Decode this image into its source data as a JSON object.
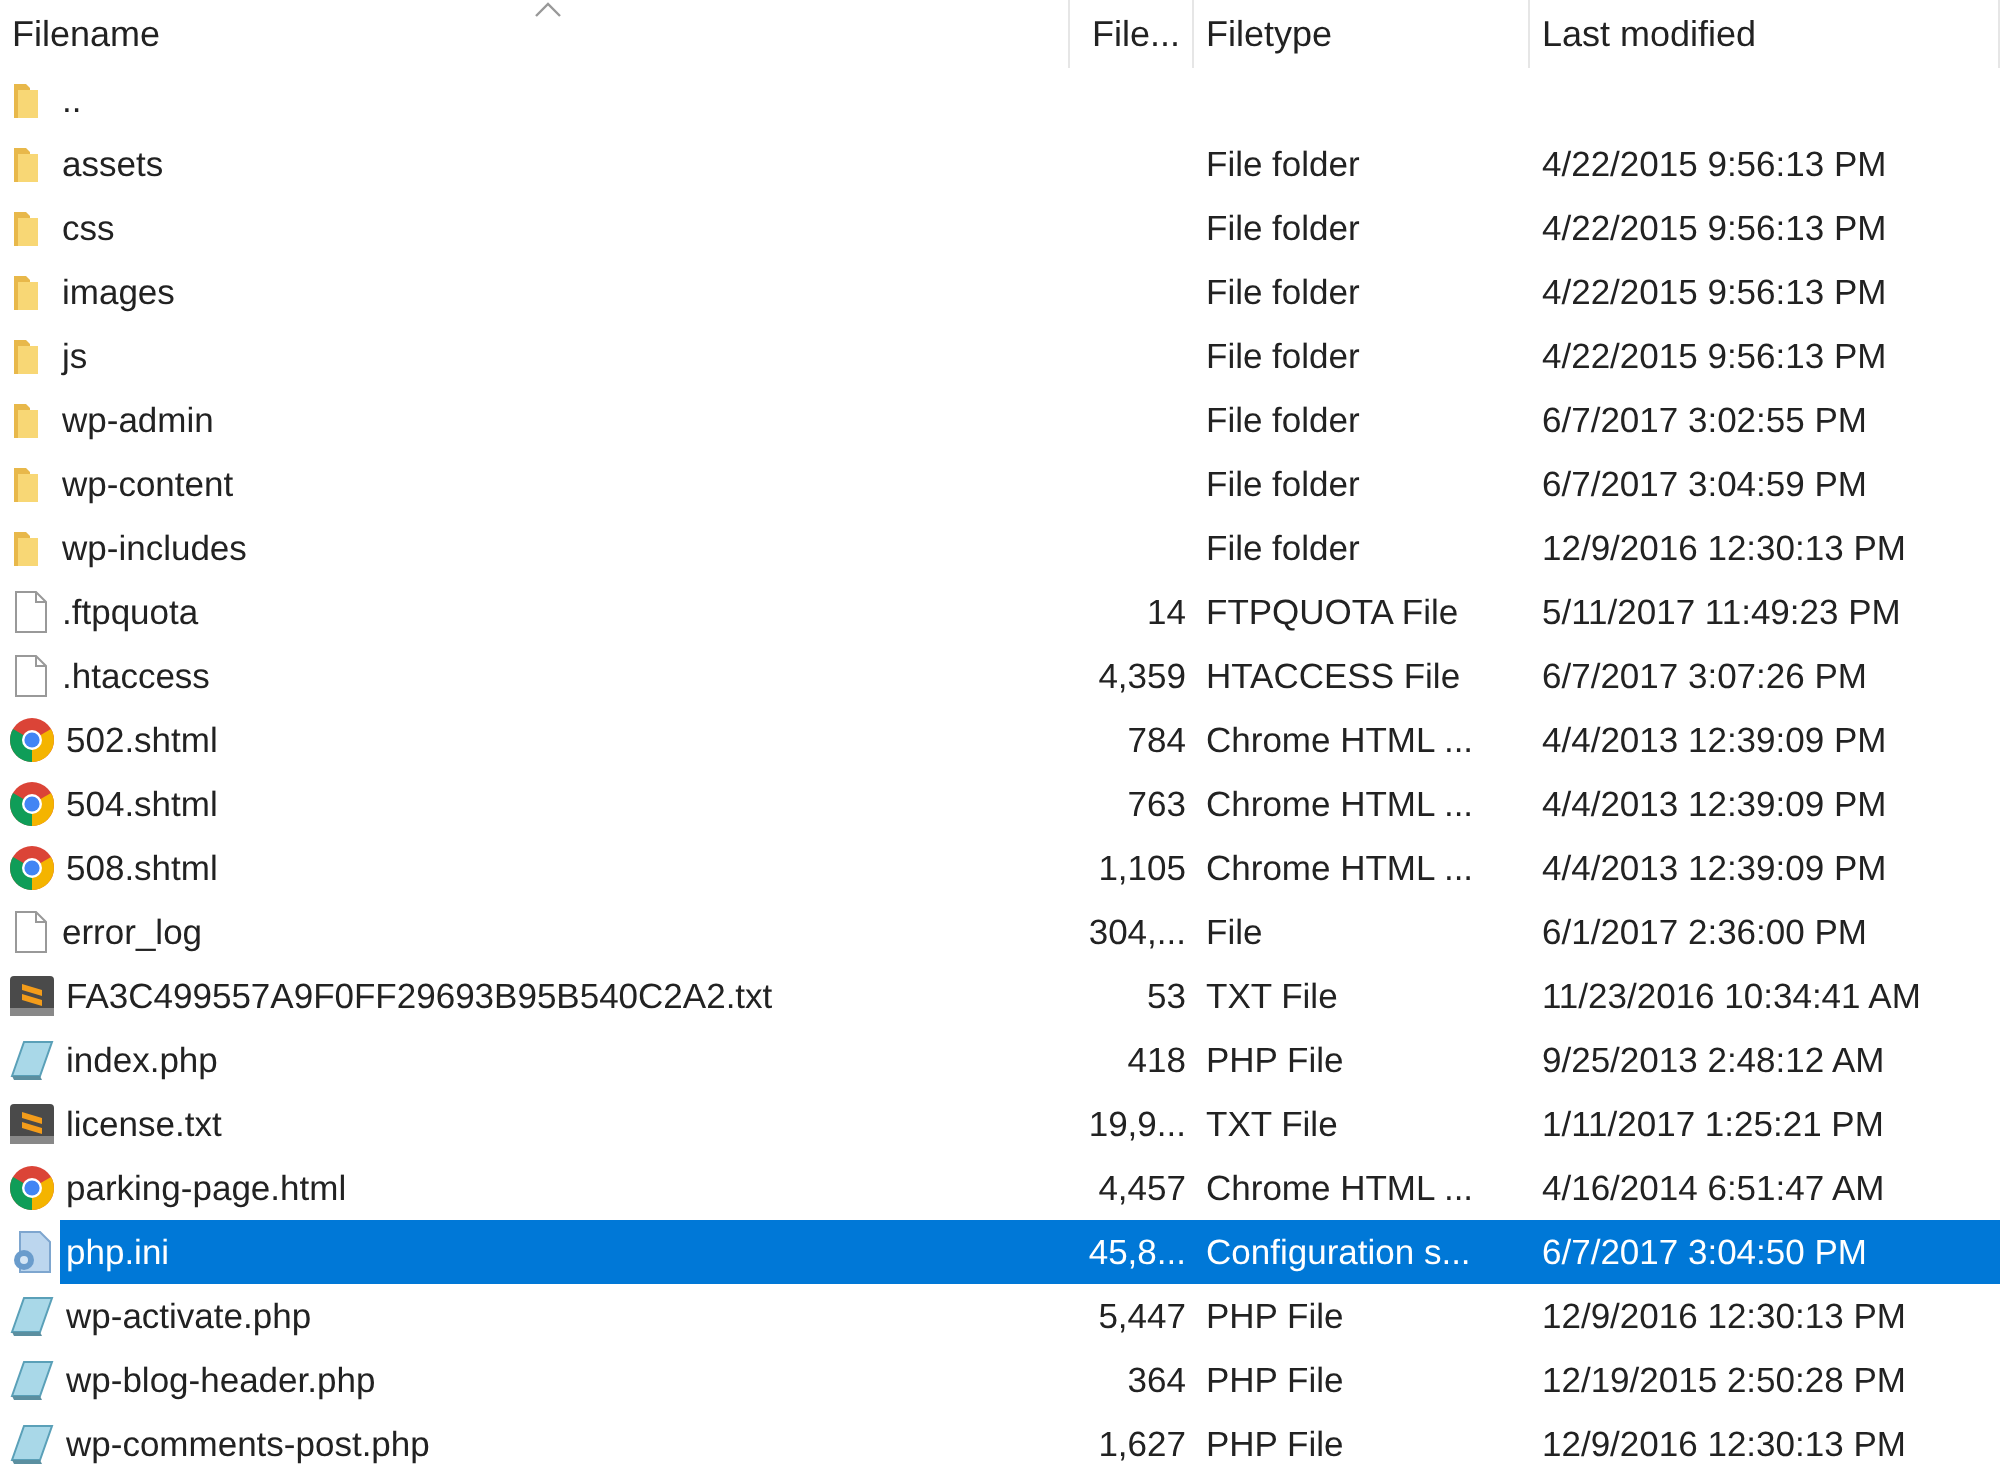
{
  "table": {
    "columns": [
      {
        "label": "Filename",
        "sorted": true
      },
      {
        "label": "File...",
        "sorted": false
      },
      {
        "label": "Filetype",
        "sorted": false
      },
      {
        "label": "Last modified",
        "sorted": false
      }
    ],
    "rows": [
      {
        "kind": "folder",
        "name": "..",
        "selected": false
      },
      {
        "kind": "folder",
        "name": "assets",
        "type": "File folder",
        "modified": "4/22/2015 9:56:13 PM",
        "selected": false
      },
      {
        "kind": "folder",
        "name": "css",
        "type": "File folder",
        "modified": "4/22/2015 9:56:13 PM",
        "selected": false
      },
      {
        "kind": "folder",
        "name": "images",
        "type": "File folder",
        "modified": "4/22/2015 9:56:13 PM",
        "selected": false
      },
      {
        "kind": "folder",
        "name": "js",
        "type": "File folder",
        "modified": "4/22/2015 9:56:13 PM",
        "selected": false
      },
      {
        "kind": "folder",
        "name": "wp-admin",
        "type": "File folder",
        "modified": "6/7/2017 3:02:55 PM",
        "selected": false
      },
      {
        "kind": "folder",
        "name": "wp-content",
        "type": "File folder",
        "modified": "6/7/2017 3:04:59 PM",
        "selected": false
      },
      {
        "kind": "folder",
        "name": "wp-includes",
        "type": "File folder",
        "modified": "12/9/2016 12:30:13 PM",
        "selected": false
      },
      {
        "kind": "file",
        "name": ".ftpquota",
        "size": "14",
        "type": "FTPQUOTA File",
        "modified": "5/11/2017 11:49:23 PM",
        "selected": false
      },
      {
        "kind": "file",
        "name": ".htaccess",
        "size": "4,359",
        "type": "HTACCESS File",
        "modified": "6/7/2017 3:07:26 PM",
        "selected": false
      },
      {
        "kind": "chrome",
        "name": "502.shtml",
        "size": "784",
        "type": "Chrome HTML ...",
        "modified": "4/4/2013 12:39:09 PM",
        "selected": false
      },
      {
        "kind": "chrome",
        "name": "504.shtml",
        "size": "763",
        "type": "Chrome HTML ...",
        "modified": "4/4/2013 12:39:09 PM",
        "selected": false
      },
      {
        "kind": "chrome",
        "name": "508.shtml",
        "size": "1,105",
        "type": "Chrome HTML ...",
        "modified": "4/4/2013 12:39:09 PM",
        "selected": false
      },
      {
        "kind": "file",
        "name": "error_log",
        "size": "304,...",
        "type": "File",
        "modified": "6/1/2017 2:36:00 PM",
        "selected": false
      },
      {
        "kind": "sublime",
        "name": "FA3C499557A9F0FF29693B95B540C2A2.txt",
        "size": "53",
        "type": "TXT File",
        "modified": "11/23/2016 10:34:41 AM",
        "selected": false
      },
      {
        "kind": "php",
        "name": "index.php",
        "size": "418",
        "type": "PHP File",
        "modified": "9/25/2013 2:48:12 AM",
        "selected": false
      },
      {
        "kind": "sublime",
        "name": "license.txt",
        "size": "19,9...",
        "type": "TXT File",
        "modified": "1/11/2017 1:25:21 PM",
        "selected": false
      },
      {
        "kind": "chrome",
        "name": "parking-page.html",
        "size": "4,457",
        "type": "Chrome HTML ...",
        "modified": "4/16/2014 6:51:47 AM",
        "selected": false
      },
      {
        "kind": "config",
        "name": "php.ini",
        "size": "45,8...",
        "type": "Configuration s...",
        "modified": "6/7/2017 3:04:50 PM",
        "selected": true
      },
      {
        "kind": "php",
        "name": "wp-activate.php",
        "size": "5,447",
        "type": "PHP File",
        "modified": "12/9/2016 12:30:13 PM",
        "selected": false
      },
      {
        "kind": "php",
        "name": "wp-blog-header.php",
        "size": "364",
        "type": "PHP File",
        "modified": "12/19/2015 2:50:28 PM",
        "selected": false
      },
      {
        "kind": "php",
        "name": "wp-comments-post.php",
        "size": "1,627",
        "type": "PHP File",
        "modified": "12/9/2016 12:30:13 PM",
        "selected": false
      }
    ]
  }
}
